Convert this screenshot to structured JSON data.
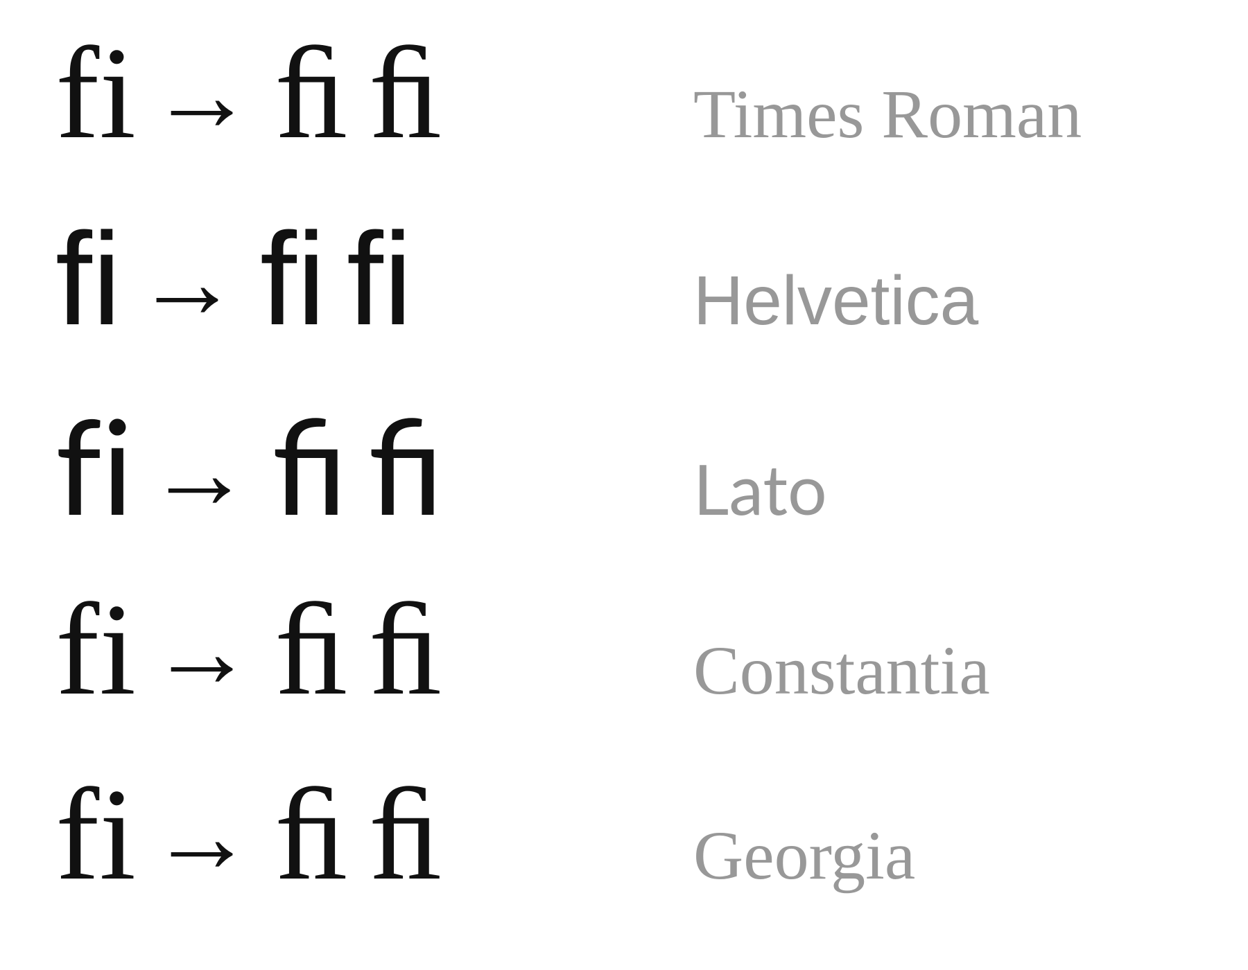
{
  "arrow_glyph": "→",
  "rows": [
    {
      "class": "f-times",
      "sample_plain": "fi",
      "sample_lig1": "ﬁ",
      "sample_lig2": "ﬁ",
      "label": "Times Roman"
    },
    {
      "class": "f-helv",
      "sample_plain": "fi",
      "sample_lig1": "ﬁ",
      "sample_lig2": "ﬁ",
      "label": "Helvetica"
    },
    {
      "class": "f-lato",
      "sample_plain": "fi",
      "sample_lig1": "ﬁ",
      "sample_lig2": "ﬁ",
      "label": "Lato"
    },
    {
      "class": "f-const",
      "sample_plain": "fi",
      "sample_lig1": "ﬁ",
      "sample_lig2": "ﬁ",
      "label": "Constantia"
    },
    {
      "class": "f-georgia",
      "sample_plain": "fi",
      "sample_lig1": "ﬁ",
      "sample_lig2": "ﬁ",
      "label": "Georgia"
    }
  ]
}
